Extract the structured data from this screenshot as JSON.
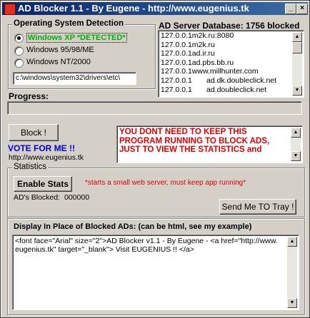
{
  "window": {
    "title": "AD Blocker 1.1 - By Eugene - http://www.eugenius.tk",
    "minimize": "_",
    "close": "×"
  },
  "os": {
    "legend": "Operating System Detection",
    "options": [
      {
        "label": "Windows XP *DETECTED*",
        "selected": true
      },
      {
        "label": "Windows 95/98/ME",
        "selected": false
      },
      {
        "label": "Windows NT/2000",
        "selected": false
      }
    ],
    "path": "c:\\windows\\system32\\drivers\\etc\\"
  },
  "database": {
    "title": "AD Server Database: 1756 blocked",
    "entries": [
      {
        "ip": "127.0.0.1",
        "host": "m2k.ru:8080"
      },
      {
        "ip": "127.0.0.1",
        "host": "m2k.ru"
      },
      {
        "ip": "127.0.0.1",
        "host": "ad.ir.ru"
      },
      {
        "ip": "127.0.0.1",
        "host": "ad.pbs.bb.ru"
      },
      {
        "ip": "127.0.0.1",
        "host": "www.millhunter.com"
      },
      {
        "ip": "127.0.0.1",
        "host": "ad.dk.doubleclick.net"
      },
      {
        "ip": "127.0.0.1",
        "host": "ad.doubleclick.net"
      }
    ]
  },
  "progress": {
    "label": "Progress:",
    "value": 0
  },
  "actions": {
    "block_label": "Block !",
    "vote_label": "VOTE FOR ME !!",
    "vote_url": "http://www.eugenius.tk"
  },
  "notice": {
    "text": "YOU DONT NEED TO KEEP THIS PROGRAM RUNNING TO BLOCK ADS, JUST TO VIEW THE STATISTICS and"
  },
  "statistics": {
    "legend": "Statistics",
    "enable_label": "Enable Stats",
    "enable_note": "*starts a small web server, must keep app running*",
    "blocked_label": "AD's Blocked:",
    "blocked_count": "000000",
    "tray_label": "Send Me TO Tray !"
  },
  "display": {
    "label": "Display In Place of Blocked ADs: (can be html, see my example)",
    "html": "<font face=\"Arial\" size=\"2\">AD Blocker v1.1 - By Eugene - <a href=\"http://www.eugenius.tk\" target=\"_blank\"> Visit EUGENIUS !! </a>"
  },
  "colors": {
    "titlebar_start": "#0a246a",
    "titlebar_end": "#3a6ea5",
    "detected": "#00b000",
    "notice": "#e00000",
    "vote": "#0000e0",
    "note": "#e00000",
    "face": "#d4d0c8"
  }
}
